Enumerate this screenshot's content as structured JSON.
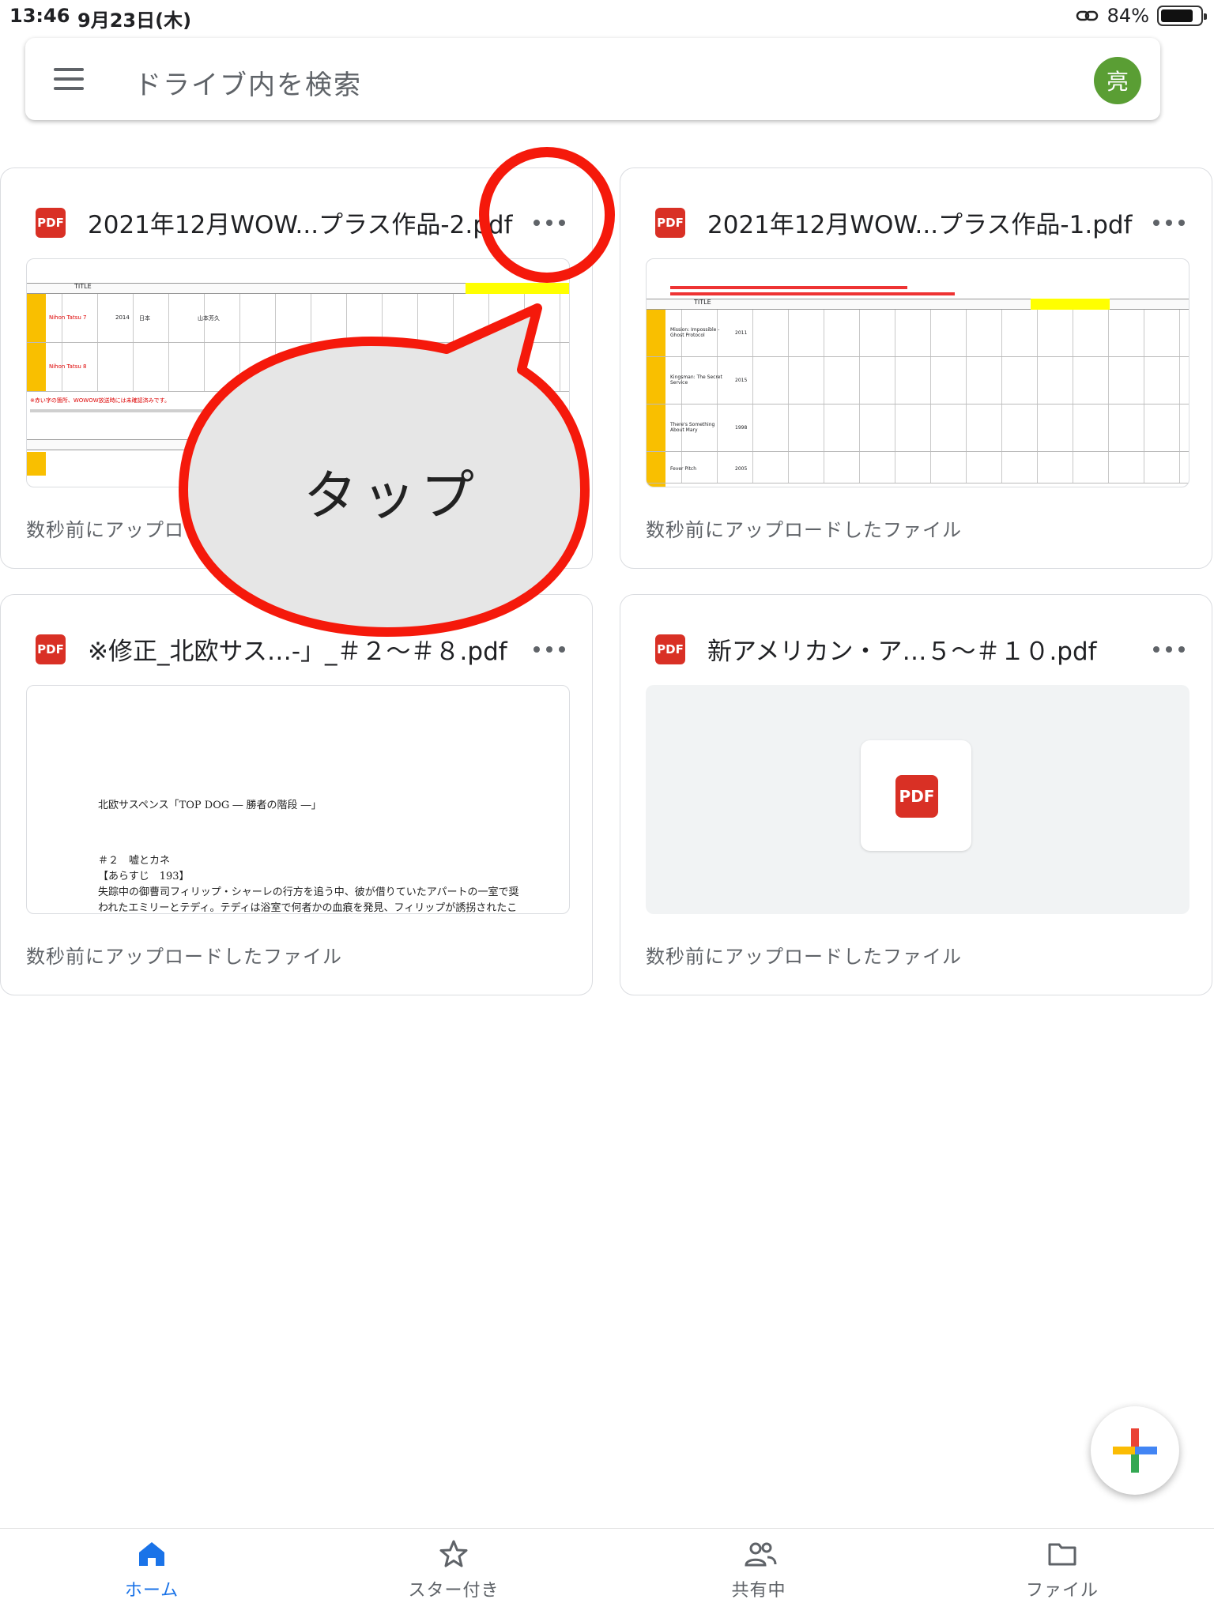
{
  "status_bar": {
    "time": "13:46",
    "date": "9月23日(木)",
    "battery": "84%",
    "battery_level": 0.84
  },
  "search": {
    "placeholder": "ドライブ内を検索",
    "avatar_letter": "亮"
  },
  "files": [
    {
      "title": "2021年12月WOW...プラス作品-2.pdf",
      "caption": "数秒前にアップロードしたファイル",
      "type_badge": "PDF",
      "thumb_texts": [
        "TITLE",
        "Nihon Tatsu 7",
        "Nihon Tatsu 8",
        "2014",
        "日本",
        "山本芳久",
        "※赤い字の箇所、WOWOW放送時には未確認済みです。"
      ]
    },
    {
      "title": "2021年12月WOW...プラス作品-1.pdf",
      "caption": "数秒前にアップロードしたファイル",
      "type_badge": "PDF",
      "thumb_texts": [
        "TITLE",
        "Mission: Impossible - Ghost Protocol",
        "Kingsman: The Secret Service",
        "There's Something About Mary",
        "Fever Pitch",
        "2011",
        "2015",
        "1998",
        "2005"
      ]
    },
    {
      "title": "※修正_北欧サス…-」_＃２～＃８.pdf",
      "caption": "数秒前にアップロードしたファイル",
      "type_badge": "PDF",
      "thumb_texts": [
        "北欧サスペンス「TOP DOG ― 勝者の階段 ―」",
        "＃２　嘘とカネ",
        "【あらすじ　193】",
        "失踪中の御曹司フィリップ・シャーレの行方を追う中、彼が借りていたアパートの一室で奨",
        "われたエミリーとテディ。テディは浴室で何者かの血痕を発見、フィリップが誘拐されたこ"
      ]
    },
    {
      "title": "新アメリカン・ア…５～＃１０.pdf",
      "caption": "数秒前にアップロードしたファイル",
      "type_badge": "PDF",
      "thumb_texts": [
        "PDF"
      ]
    }
  ],
  "annotation": {
    "bubble_text": "タップ"
  },
  "bottom_nav": [
    {
      "label": "ホーム",
      "icon": "home-icon",
      "active": true
    },
    {
      "label": "スター付き",
      "icon": "star-icon",
      "active": false
    },
    {
      "label": "共有中",
      "icon": "people-icon",
      "active": false
    },
    {
      "label": "ファイル",
      "icon": "folder-icon",
      "active": false
    }
  ],
  "colors": {
    "pdf_red": "#d93025",
    "accent_blue": "#1a73e8",
    "avatar_green": "#5a9e34",
    "annotation_red": "#f5190b"
  }
}
